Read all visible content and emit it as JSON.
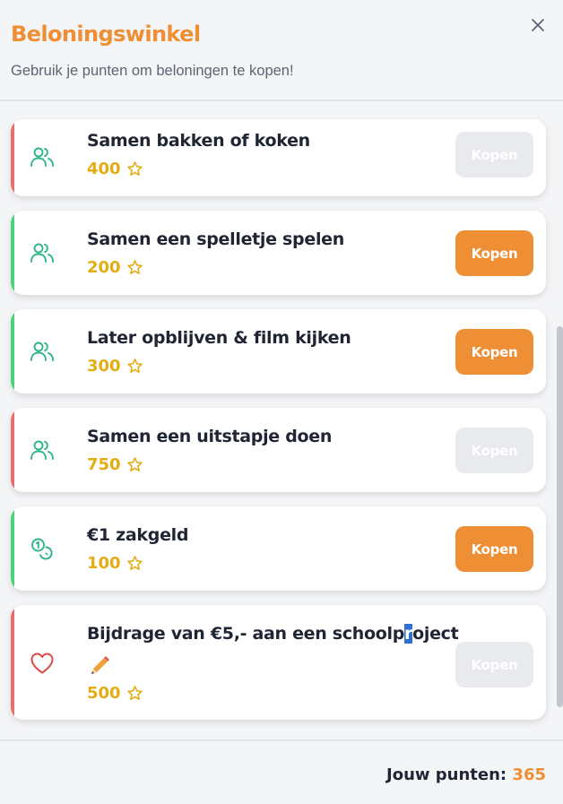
{
  "header": {
    "title": "Beloningswinkel",
    "subtitle": "Gebruik je punten om beloningen te kopen!",
    "close_icon": "close-icon"
  },
  "rewards": [
    {
      "name": "Samen bakken of koken",
      "cost": "400",
      "affordable": false,
      "icon": "users-icon",
      "bar_color": "#e86d6d",
      "button": "Kopen"
    },
    {
      "name": "Samen een spelletje spelen",
      "cost": "200",
      "affordable": true,
      "icon": "users-icon",
      "bar_color": "#4cd27b",
      "button": "Kopen"
    },
    {
      "name": "Later opblijven & film kijken",
      "cost": "300",
      "affordable": true,
      "icon": "users-icon",
      "bar_color": "#4cd27b",
      "button": "Kopen"
    },
    {
      "name": "Samen een uitstapje doen",
      "cost": "750",
      "affordable": false,
      "icon": "users-icon",
      "bar_color": "#e86d6d",
      "button": "Kopen"
    },
    {
      "name": "€1 zakgeld",
      "cost": "100",
      "affordable": true,
      "icon": "coins-icon",
      "bar_color": "#4cd27b",
      "button": "Kopen"
    },
    {
      "name_before": "Bijdrage van €5,- aan een schoolp",
      "name_selected": "r",
      "name_after": "oject",
      "name_emoji": "✏️",
      "cost": "500",
      "affordable": false,
      "icon": "heart-icon",
      "bar_color": "#e86d6d",
      "button": "Kopen"
    }
  ],
  "footer": {
    "points_label": "Jouw punten:",
    "points_value": "365"
  },
  "colors": {
    "accent": "#ef8f35",
    "star": "#e3ad12",
    "icon_green": "#2fb58a",
    "heart_red": "#e04848"
  }
}
